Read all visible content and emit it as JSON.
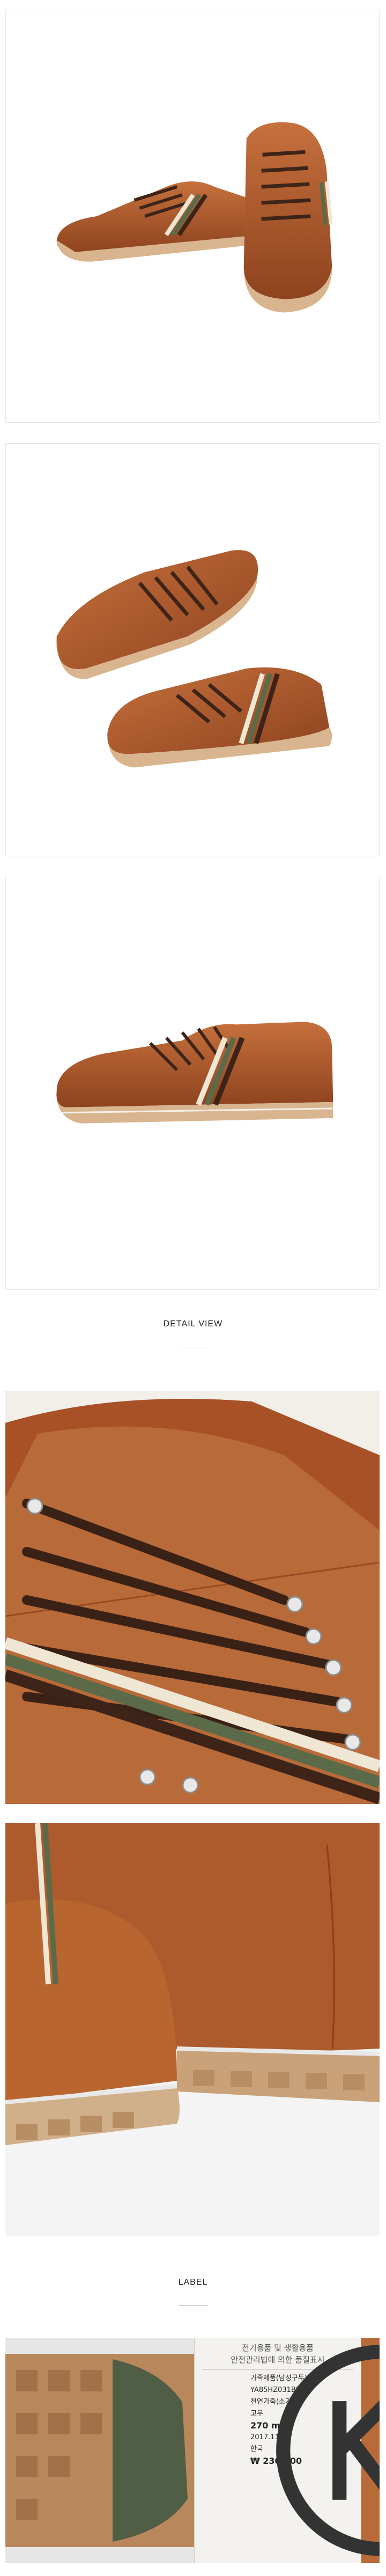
{
  "sections": {
    "detail_heading": "DETAIL VIEW",
    "label_heading": "LABEL"
  },
  "colors": {
    "leather": "#b25a2c",
    "leather_dark": "#8a3f1c",
    "sole": "#d9b58f",
    "lace": "#3e2418",
    "stripe_green": "#5b6b4a",
    "stripe_cream": "#efe6d3"
  },
  "label_card": {
    "title_line_1": "전기용품 및 생활용품",
    "title_line_2": "안전관리법에 의한 품질표시",
    "rows": [
      {
        "key": "",
        "value": "가죽제품(남성구두)"
      },
      {
        "key": "",
        "value": "YA85HZ031BR"
      },
      {
        "key": "",
        "value": ""
      },
      {
        "key": "",
        "value": "천연가죽(소가죽)"
      },
      {
        "key": "",
        "value": "고무"
      },
      {
        "key": "",
        "value": "270 mm"
      },
      {
        "key": "",
        "value": "2017.11"
      },
      {
        "key": "",
        "value": "한국"
      },
      {
        "key": "",
        "value": ""
      },
      {
        "key": "",
        "value": "₩ 230,000"
      }
    ]
  }
}
